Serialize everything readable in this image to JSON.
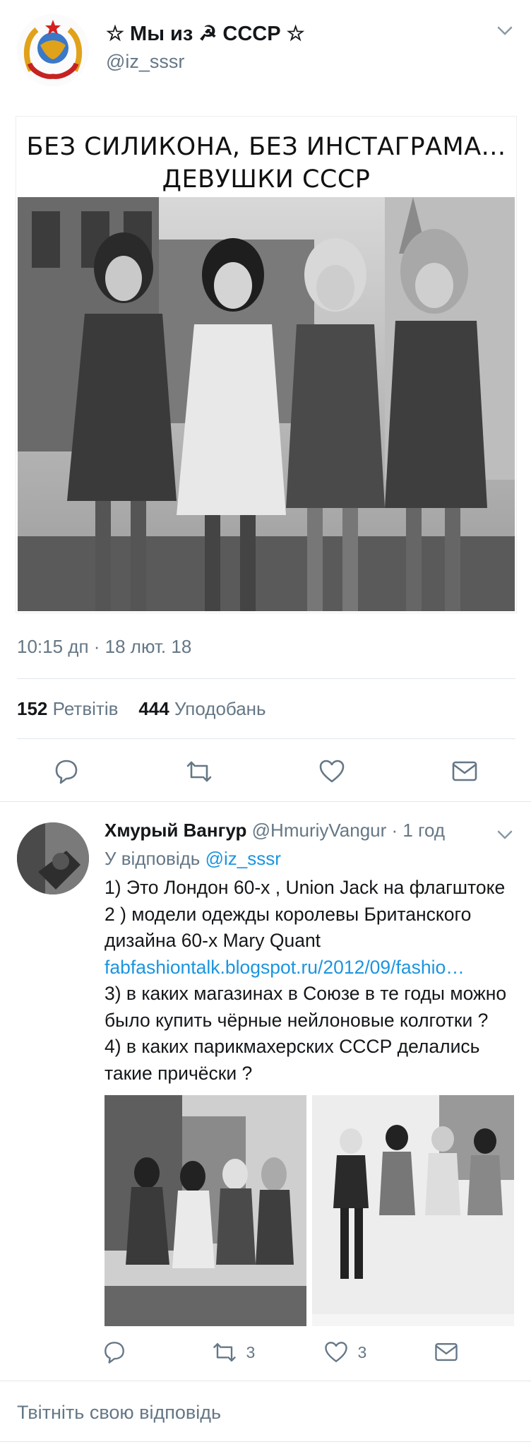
{
  "tweet": {
    "display_name": "☆ Мы из ☭ СССР ☆",
    "handle": "@iz_sssr",
    "card_headline_line1": "БЕЗ СИЛИКОНА, БЕЗ ИНСТАГРАМА...",
    "card_headline_line2": "ДЕВУШКИ СССР",
    "timestamp": "10:15 дп · 18 лют. 18",
    "retweets_count": "152",
    "retweets_label": "Ретвітів",
    "likes_count": "444",
    "likes_label": "Уподобань"
  },
  "reply": {
    "display_name": "Хмурый Вангур",
    "handle": "@HmuriyVangur",
    "time": "· 1 год",
    "replying_prefix": "У відповідь",
    "replying_handle": "@iz_sssr",
    "text_part1": "1) Это Лондон 60-х , Union Jack на флагштоке 2 ) модели одежды королевы Британского дизайна 60-х  Mary Quant",
    "link": "fabfashiontalk.blogspot.ru/2012/09/fashio…",
    "text_part2": "3)  в каких магазинах в Союзе в те годы можно было купить чёрные нейлоновые колготки ? 4) в каких парикмахерских СССР делались такие причёски ?",
    "retweet_count": "3",
    "like_count": "3"
  },
  "compose": {
    "placeholder": "Твітніть свою відповідь"
  },
  "icons": {
    "reply": "reply-icon",
    "retweet": "retweet-icon",
    "like": "heart-icon",
    "message": "envelope-icon",
    "menu": "chevron-down-icon"
  },
  "colors": {
    "link": "#1b95e0",
    "secondary_text": "#657786",
    "divider": "#e1e8ed"
  }
}
